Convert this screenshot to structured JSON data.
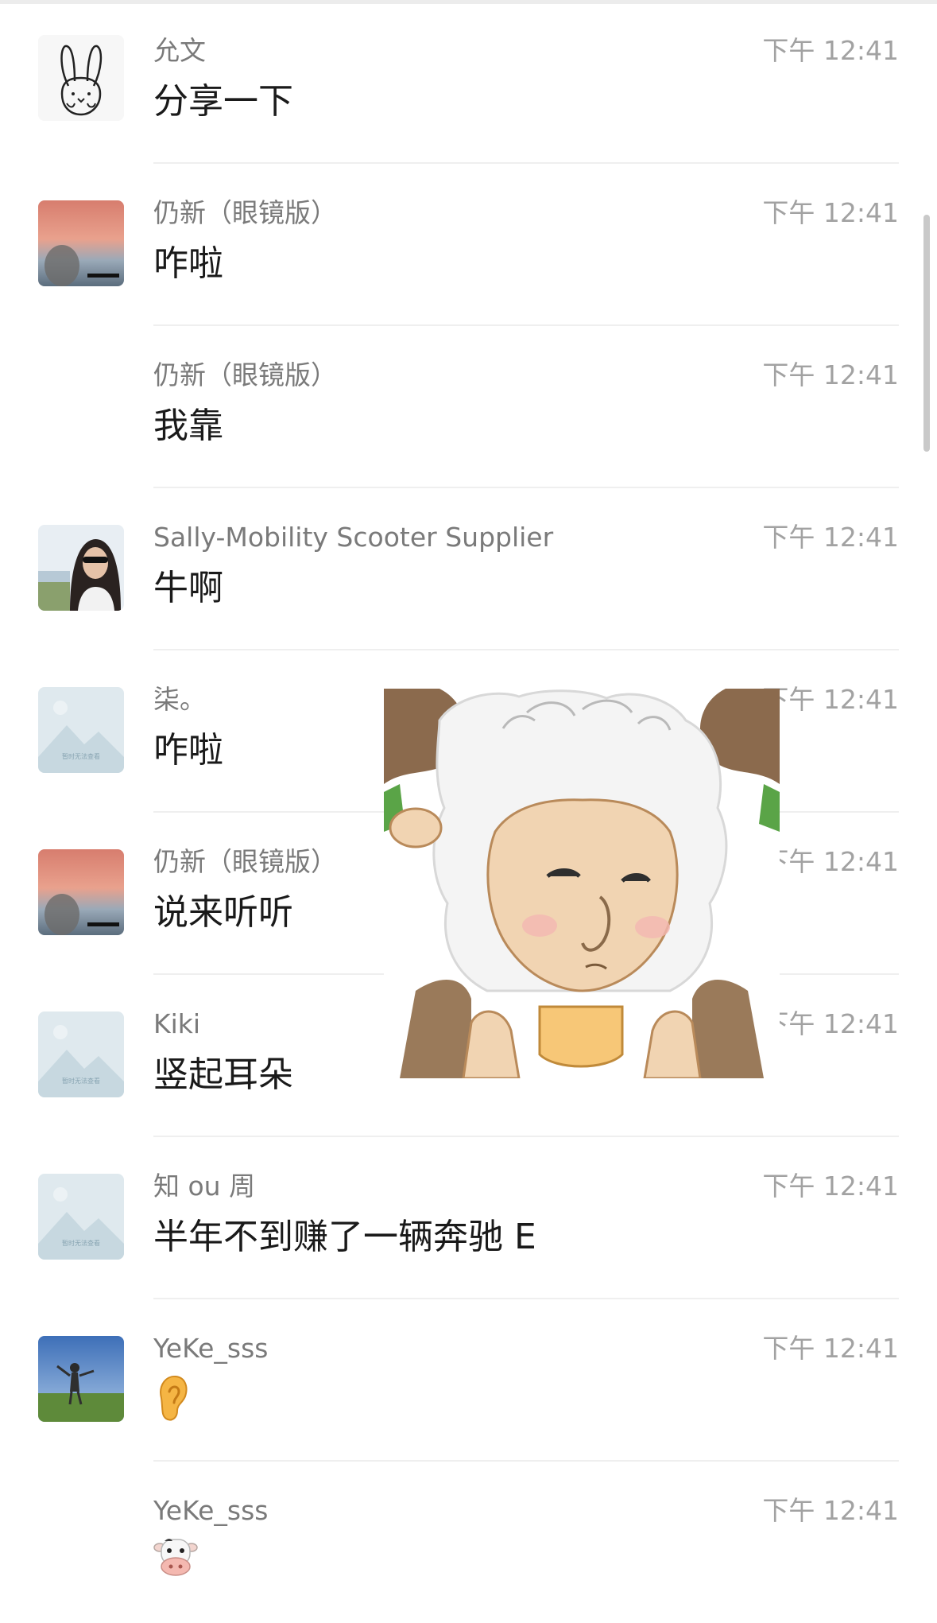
{
  "messages": [
    {
      "sender": "允文",
      "time": "下午 12:41",
      "content": "分享一下",
      "avatar": "rabbit-avatar"
    },
    {
      "sender": "仍新（眼镜版）",
      "time": "下午 12:41",
      "content": "咋啦",
      "avatar": "sunset-avatar"
    },
    {
      "sender": "仍新（眼镜版）",
      "time": "下午 12:41",
      "content": "我靠",
      "avatar": ""
    },
    {
      "sender": "Sally-Mobility Scooter Supplier",
      "time": "下午 12:41",
      "content": "牛啊",
      "avatar": "woman-sunglasses-avatar"
    },
    {
      "sender": "柒。",
      "time": "下午 12:41",
      "content": "咋啦",
      "avatar": "placeholder-avatar",
      "avatar_caption": "暂时无法查看"
    },
    {
      "sender": "仍新（眼镜版）",
      "time": "下午 12:41",
      "content": "说来听听",
      "avatar": "sunset-avatar"
    },
    {
      "sender": "Kiki",
      "time": "下午 12:41",
      "content": "竖起耳朵",
      "avatar": "placeholder-avatar",
      "avatar_caption": "暂时无法查看"
    },
    {
      "sender": "知 ou 周",
      "time": "下午 12:41",
      "content": "半年不到赚了一辆奔驰 E",
      "avatar": "placeholder-avatar",
      "avatar_caption": "暂时无法查看"
    },
    {
      "sender": "YeKe_sss",
      "time": "下午 12:41",
      "content": "ear-emoji",
      "avatar": "field-person-avatar"
    },
    {
      "sender": "YeKe_sss",
      "time": "下午 12:41",
      "content": "cow-emoji",
      "avatar": ""
    }
  ],
  "sticker": {
    "name": "sheep-meme-sticker"
  },
  "colors": {
    "background": "#ffffff",
    "sender_text": "#7a7a7a",
    "time_text": "#a2a2a2",
    "content_text": "#1a1a1a",
    "divider": "#efefef",
    "scrollbar": "#c9c9c9"
  }
}
